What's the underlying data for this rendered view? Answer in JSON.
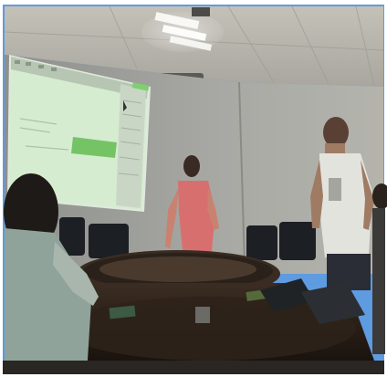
{
  "scene": {
    "subject": "meeting-room-with-projector",
    "colors": {
      "frame": "#5f9be0",
      "ceiling": "#b8b4ac",
      "wall": "#9fa19c",
      "screen": "#d9ecd0",
      "slide_green": "#74c466",
      "table": "#2b2119",
      "chairs": "#1c1f24",
      "person_red_shirt": "#d86f6f",
      "person_white_shirt": "#e3e3de"
    }
  }
}
